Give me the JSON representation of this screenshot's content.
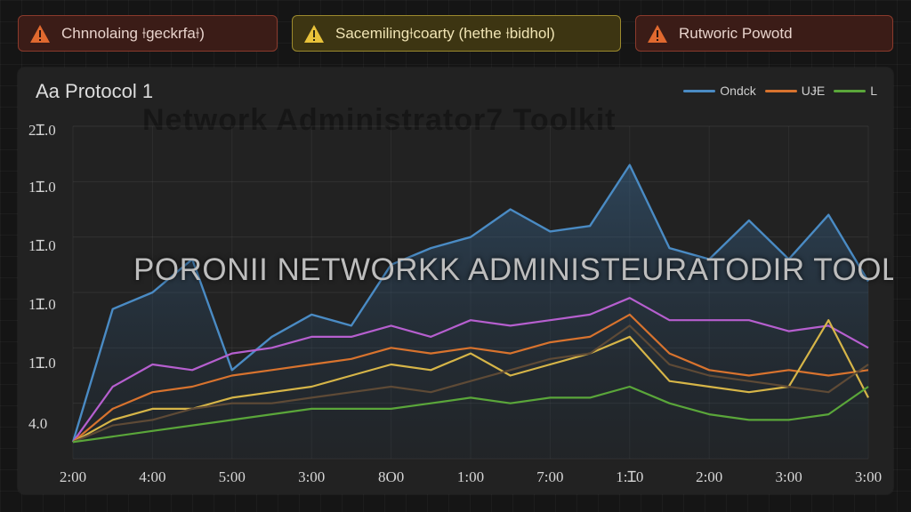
{
  "alerts": [
    {
      "label": "Chnnolaing ⟊geckrfa⟊)",
      "level": "error"
    },
    {
      "label": "Sacemiling⟊coarty (hethe ⟊bidhol)",
      "level": "warning"
    },
    {
      "label": "Rutworic Powotd",
      "level": "error"
    }
  ],
  "panel": {
    "title": "Aa Protocol 1",
    "ghost_title": "Network Administrator7 Toolkit",
    "watermark": "PORONII NETWORKK ADMINISTEURATODIR TOOLKIT"
  },
  "chart_data": {
    "type": "line",
    "ylabels": [
      "4.0",
      "1Ɪ.0",
      "1Ɪ.0",
      "1Ɪ.0",
      "1Ɪ.0",
      "2Ɪ.0"
    ],
    "xlabels": [
      "2:00",
      "4:00",
      "5:00",
      "3:00",
      "8O0",
      "1:00",
      "7:00",
      "1:Ɪ0",
      "2:00",
      "3:00",
      "3:00"
    ],
    "legend": [
      {
        "name": "Ondck",
        "color": "#4a8bc4"
      },
      {
        "name": "UɈE",
        "color": "#d8732e"
      },
      {
        "name": "L",
        "color": "#5aa63a"
      }
    ],
    "ylim": [
      0,
      6
    ],
    "grid": true,
    "series": [
      {
        "color": "#4a8bc4",
        "fill": true,
        "values": [
          0.3,
          2.7,
          3.0,
          3.6,
          1.6,
          2.2,
          2.6,
          2.4,
          3.5,
          3.8,
          4.0,
          4.5,
          4.1,
          4.2,
          5.3,
          3.8,
          3.6,
          4.3,
          3.6,
          4.4,
          3.2
        ]
      },
      {
        "color": "#b65fcf",
        "fill": false,
        "values": [
          0.3,
          1.3,
          1.7,
          1.6,
          1.9,
          2.0,
          2.2,
          2.2,
          2.4,
          2.2,
          2.5,
          2.4,
          2.5,
          2.6,
          2.9,
          2.5,
          2.5,
          2.5,
          2.3,
          2.4,
          2.0
        ]
      },
      {
        "color": "#d8732e",
        "fill": false,
        "values": [
          0.3,
          0.9,
          1.2,
          1.3,
          1.5,
          1.6,
          1.7,
          1.8,
          2.0,
          1.9,
          2.0,
          1.9,
          2.1,
          2.2,
          2.6,
          1.9,
          1.6,
          1.5,
          1.6,
          1.5,
          1.6
        ]
      },
      {
        "color": "#d6b548",
        "fill": false,
        "values": [
          0.3,
          0.7,
          0.9,
          0.9,
          1.1,
          1.2,
          1.3,
          1.5,
          1.7,
          1.6,
          1.9,
          1.5,
          1.7,
          1.9,
          2.2,
          1.4,
          1.3,
          1.2,
          1.3,
          2.5,
          1.1
        ]
      },
      {
        "color": "#5e4a36",
        "fill": false,
        "values": [
          0.3,
          0.6,
          0.7,
          0.9,
          1.0,
          1.0,
          1.1,
          1.2,
          1.3,
          1.2,
          1.4,
          1.6,
          1.8,
          1.9,
          2.4,
          1.7,
          1.5,
          1.4,
          1.3,
          1.2,
          1.7
        ]
      },
      {
        "color": "#5aa63a",
        "fill": false,
        "values": [
          0.3,
          0.4,
          0.5,
          0.6,
          0.7,
          0.8,
          0.9,
          0.9,
          0.9,
          1.0,
          1.1,
          1.0,
          1.1,
          1.1,
          1.3,
          1.0,
          0.8,
          0.7,
          0.7,
          0.8,
          1.3
        ]
      }
    ]
  }
}
